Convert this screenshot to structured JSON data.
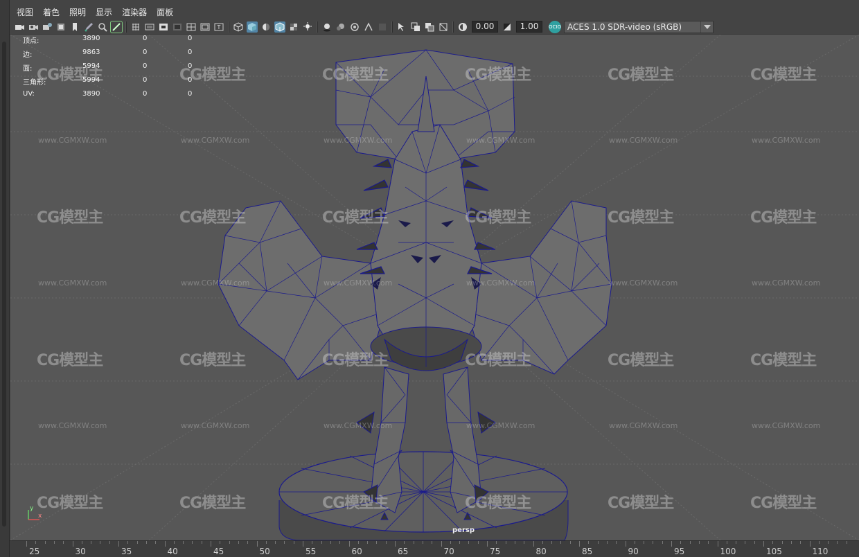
{
  "menubar": {
    "items": [
      "视图",
      "着色",
      "照明",
      "显示",
      "渲染器",
      "面板"
    ]
  },
  "toolbar": {
    "exposure_value": "0.00",
    "gamma_value": "1.00",
    "ocio_label": "OCIO",
    "view_transform": "ACES 1.0 SDR-video (sRGB)",
    "accent_color": "#5285a6"
  },
  "hud": {
    "rows": [
      {
        "label": "顶点:",
        "v1": "3890",
        "v2": "0",
        "v3": "0"
      },
      {
        "label": "边:",
        "v1": "9863",
        "v2": "0",
        "v3": "0"
      },
      {
        "label": "面:",
        "v1": "5994",
        "v2": "0",
        "v3": "0"
      },
      {
        "label": "三角形:",
        "v1": "5994",
        "v2": "0",
        "v3": "0"
      },
      {
        "label": "UV:",
        "v1": "3890",
        "v2": "0",
        "v3": "0"
      }
    ]
  },
  "viewport": {
    "camera_label": "persp",
    "axis_y": "y",
    "axis_x": "x",
    "wireframe_color": "#1a1a8c",
    "mesh_color": "#6b6b6b",
    "background_color": "#575757"
  },
  "watermark": {
    "brand": "CG模型主",
    "url": "www.CGMXW.com"
  },
  "timeline": {
    "ticks": [
      "25",
      "30",
      "35",
      "40",
      "45",
      "50",
      "55",
      "60",
      "65",
      "70",
      "75",
      "80",
      "85",
      "90",
      "95",
      "100",
      "105",
      "110"
    ]
  }
}
